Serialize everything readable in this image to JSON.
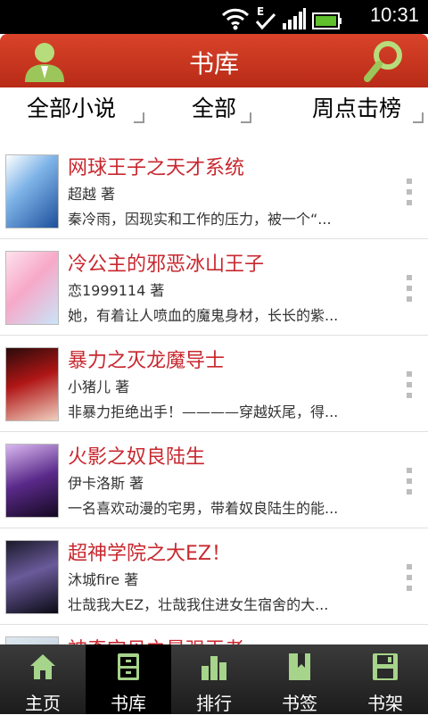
{
  "status": {
    "time": "10:31"
  },
  "header": {
    "title": "书库"
  },
  "filters": [
    "全部小说",
    "全部",
    "周点击榜"
  ],
  "books": [
    {
      "title": "网球王子之天才系统",
      "author": "超越 著",
      "desc": "秦冷雨，因现实和工作的压力，被一个“..."
    },
    {
      "title": "冷公主的邪恶冰山王子",
      "author": "恋1999114 著",
      "desc": "她，有着让人喷血的魔鬼身材，长长的紫..."
    },
    {
      "title": "暴力之灭龙魔导士",
      "author": "小猪儿 著",
      "desc": "非暴力拒绝出手！————穿越妖尾，得..."
    },
    {
      "title": "火影之奴良陆生",
      "author": "伊卡洛斯 著",
      "desc": "一名喜欢动漫的宅男，带着奴良陆生的能..."
    },
    {
      "title": "超神学院之大EZ！",
      "author": "沐城fire 著",
      "desc": "壮哉我大EZ，壮哉我住进女生宿舍的大..."
    },
    {
      "title": "神奇宝贝之最强王者",
      "author": "",
      "desc": ""
    }
  ],
  "tabs": [
    "主页",
    "书库",
    "排行",
    "书签",
    "书架"
  ],
  "colors": {
    "header": "#c0301b",
    "title_red": "#c8282f",
    "tab_icon": "#a6d48a"
  }
}
